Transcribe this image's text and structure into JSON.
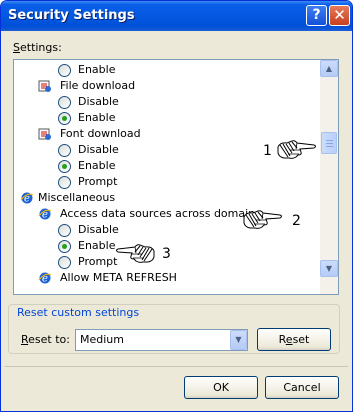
{
  "window": {
    "title": "Security Settings",
    "help_glyph": "?",
    "close_glyph": "✕"
  },
  "settings_label": {
    "text": "Settings:",
    "mnemonic": "S",
    "rest": "ettings:"
  },
  "list_rows": [
    {
      "kind": "radio",
      "label": "Enable",
      "checked": false
    },
    {
      "kind": "setting",
      "label": "File download",
      "icon": "script-setting-icon"
    },
    {
      "kind": "radio",
      "label": "Disable",
      "checked": false
    },
    {
      "kind": "radio",
      "label": "Enable",
      "checked": true
    },
    {
      "kind": "setting",
      "label": "Font download",
      "icon": "script-setting-icon"
    },
    {
      "kind": "radio",
      "label": "Disable",
      "checked": false
    },
    {
      "kind": "radio",
      "label": "Enable",
      "checked": true
    },
    {
      "kind": "radio",
      "label": "Prompt",
      "checked": false
    },
    {
      "kind": "category",
      "label": "Miscellaneous",
      "icon": "ie-icon"
    },
    {
      "kind": "setting",
      "label": "Access data sources across domains",
      "icon": "ie-setting-icon"
    },
    {
      "kind": "radio",
      "label": "Disable",
      "checked": false
    },
    {
      "kind": "radio",
      "label": "Enable",
      "checked": true
    },
    {
      "kind": "radio",
      "label": "Prompt",
      "checked": false
    },
    {
      "kind": "setting",
      "label": "Allow META REFRESH",
      "icon": "ie-setting-icon"
    }
  ],
  "callouts": [
    "1",
    "2",
    "3"
  ],
  "scrollbar": {
    "up_glyph": "▲",
    "down_glyph": "▼"
  },
  "reset_group": {
    "title": "Reset custom settings",
    "reset_to_label": {
      "mnemonic": "R",
      "rest": "eset to:"
    },
    "selected_level": "Medium",
    "dropdown_glyph": "▼",
    "reset_button": {
      "prefix": "R",
      "mnemonic": "e",
      "rest": "set"
    }
  },
  "buttons": {
    "ok": "OK",
    "cancel": "Cancel"
  },
  "colors": {
    "title_bar": "#0558e0",
    "group_title": "#0046d5",
    "radio_dot": "#21a121",
    "dialog_bg": "#ece9d8"
  }
}
